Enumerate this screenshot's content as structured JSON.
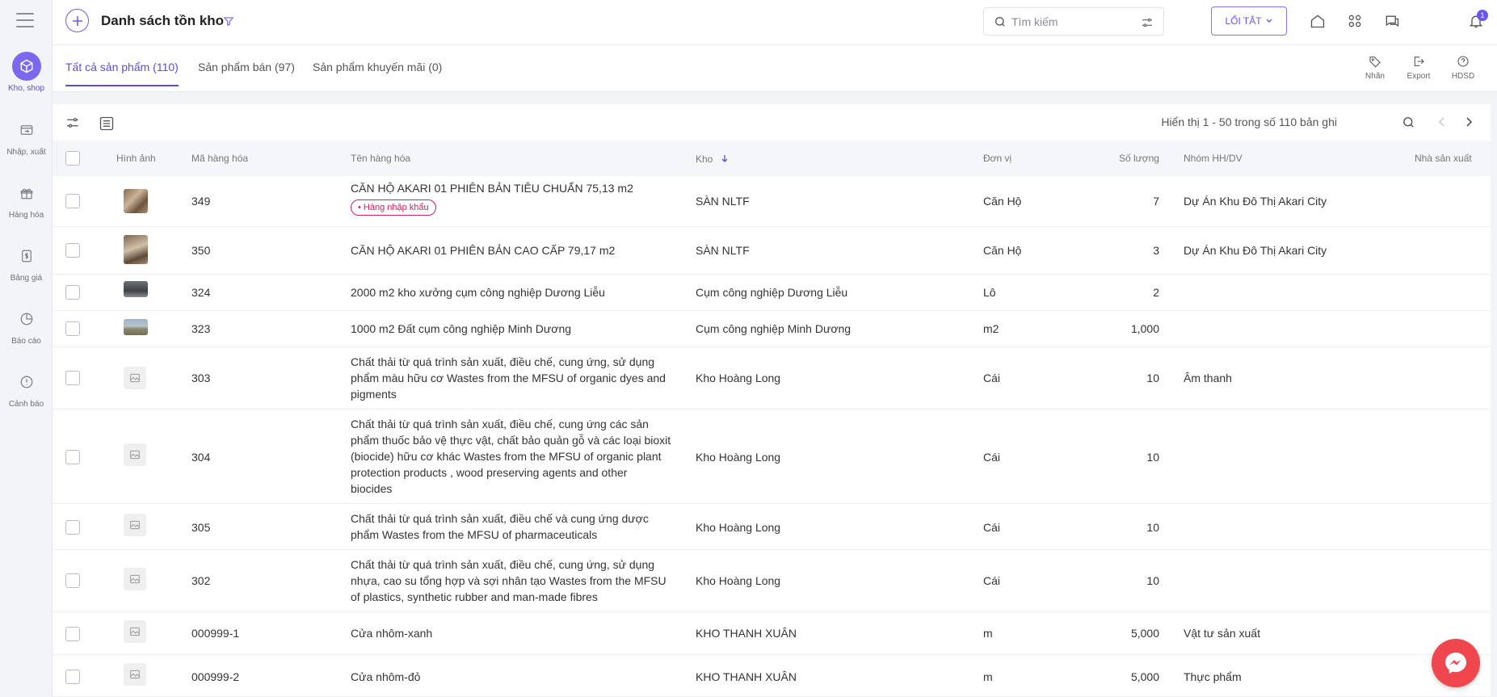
{
  "sidebar": {
    "items": [
      {
        "label": "Kho, shop",
        "icon": "box-icon"
      },
      {
        "label": "Nhập, xuất",
        "icon": "transfer-icon"
      },
      {
        "label": "Hàng hóa",
        "icon": "gift-icon"
      },
      {
        "label": "Bảng giá",
        "icon": "price-icon"
      },
      {
        "label": "Báo cáo",
        "icon": "pie-chart-icon"
      },
      {
        "label": "Cảnh báo",
        "icon": "alert-icon"
      }
    ]
  },
  "header": {
    "title": "Danh sách tồn kho",
    "search_placeholder": "Tìm kiếm",
    "shortcut_label": "LỐI TẮT",
    "notification_count": "1"
  },
  "tabs": [
    {
      "label": "Tất cả sản phẩm (110)",
      "active": true
    },
    {
      "label": "Sản phẩm bán (97)",
      "active": false
    },
    {
      "label": "Sản phẩm khuyến mãi (0)",
      "active": false
    }
  ],
  "tools": {
    "label_tag": "Nhãn",
    "export": "Export",
    "help": "HDSD"
  },
  "pager": {
    "text": "Hiển thị 1 - 50 trong số 110 bản ghi"
  },
  "columns": {
    "image": "Hình ảnh",
    "code": "Mã hàng hóa",
    "name": "Tên hàng hóa",
    "warehouse": "Kho",
    "unit": "Đơn vị",
    "qty": "Số lượng",
    "group": "Nhóm HH/DV",
    "maker": "Nhà sản xuất"
  },
  "rows": [
    {
      "code": "349",
      "name": "CĂN HỘ AKARI 01 PHIÊN BẢN TIÊU CHUẨN 75,13 m2",
      "tag": "• Hàng nhập khẩu",
      "warehouse": "SÀN NLTF",
      "unit": "Căn Hộ",
      "qty": "7",
      "group": "Dự Án Khu Đô Thị Akari City"
    },
    {
      "code": "350",
      "name": "CĂN HỘ AKARI 01 PHIÊN BẢN CAO CẤP 79,17 m2",
      "warehouse": "SÀN NLTF",
      "unit": "Căn Hộ",
      "qty": "3",
      "group": "Dự Án Khu Đô Thị Akari City"
    },
    {
      "code": "324",
      "name": "2000 m2 kho xưởng cụm công nghiệp Dương Liễu",
      "warehouse": "Cụm công nghiệp Dương Liễu",
      "unit": "Lô",
      "qty": "2",
      "group": ""
    },
    {
      "code": "323",
      "name": "1000 m2 Đất cụm công nghiệp Minh Dương",
      "warehouse": "Cụm công nghiệp Minh Dương",
      "unit": "m2",
      "qty": "1,000",
      "group": ""
    },
    {
      "code": "303",
      "name_lines": [
        "Chất thải từ quá trình sản xuất, điều chế, cung ứng, sử dụng",
        "phẩm màu hữu cơ Wastes from the MFSU of organic dyes and",
        "pigments"
      ],
      "warehouse": "Kho Hoàng Long",
      "unit": "Cái",
      "qty": "10",
      "group": "Âm thanh"
    },
    {
      "code": "304",
      "name_lines": [
        "Chất thải từ quá trình sản xuất, điều chế, cung ứng các sản",
        "phẩm thuốc bảo vệ thực vật, chất bảo quản gỗ và các loại bioxit",
        "(biocide) hữu cơ khác Wastes from the MFSU of organic plant",
        "protection products , wood preserving agents and other",
        "biocides"
      ],
      "warehouse": "Kho Hoàng Long",
      "unit": "Cái",
      "qty": "10",
      "group": ""
    },
    {
      "code": "305",
      "name_lines": [
        "Chất thải từ quá trình sản xuất, điều chế và cung ứng dược",
        "phẩm Wastes from the MFSU of pharmaceuticals"
      ],
      "warehouse": "Kho Hoàng Long",
      "unit": "Cái",
      "qty": "10",
      "group": ""
    },
    {
      "code": "302",
      "name_lines": [
        "Chất thải từ quá trình sản xuất, điều chế, cung ứng, sử dụng",
        "nhựa, cao su tổng hợp và sợi nhân tạo Wastes from the MFSU",
        "of plastics, synthetic rubber and man-made fibres"
      ],
      "warehouse": "Kho Hoàng Long",
      "unit": "Cái",
      "qty": "10",
      "group": ""
    },
    {
      "code": "000999-1",
      "name": "Cửa nhôm-xanh",
      "warehouse": "KHO THANH XUÂN",
      "unit": "m",
      "qty": "5,000",
      "group": "Vật tư sản xuất"
    },
    {
      "code": "000999-2",
      "name": "Cửa nhôm-đỏ",
      "warehouse": "KHO THANH XUÂN",
      "unit": "m",
      "qty": "5,000",
      "group": "Thực phẩm"
    }
  ]
}
